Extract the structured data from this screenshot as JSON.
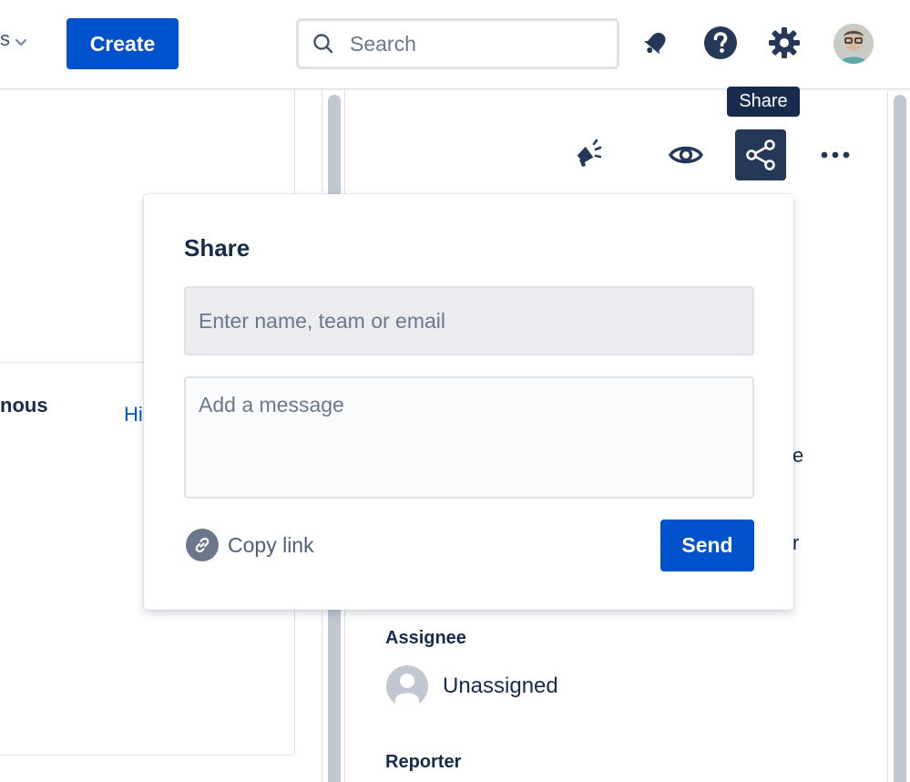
{
  "topbar": {
    "nav_fragment": "s",
    "create_label": "Create",
    "search_placeholder": "Search"
  },
  "left_panel": {
    "bold_fragment": "nous",
    "link_fragment": "Hi"
  },
  "toolbar": {
    "tooltip": "Share"
  },
  "background": {
    "frag_1": "e",
    "frag_2": "r",
    "assignee_label": "Assignee",
    "assignee_value": "Unassigned",
    "reporter_label": "Reporter"
  },
  "share_popover": {
    "title": "Share",
    "recipient_placeholder": "Enter name, team or email",
    "message_placeholder": "Add a message",
    "copy_link_label": "Copy link",
    "send_label": "Send"
  },
  "colors": {
    "brand_blue": "#0052cc",
    "dark_navy": "#172b4d",
    "active_icon_bg": "#253858"
  }
}
